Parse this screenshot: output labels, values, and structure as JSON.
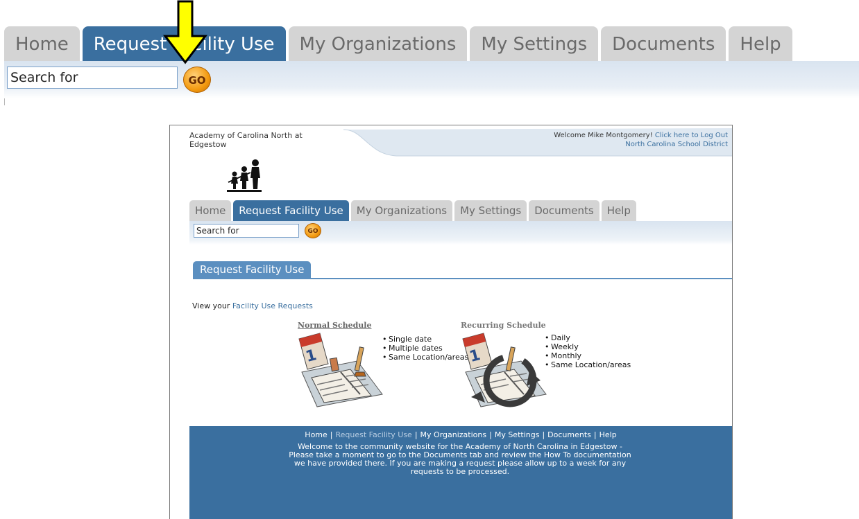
{
  "big_nav": {
    "tabs": [
      {
        "label": "Home",
        "active": false
      },
      {
        "label": "Request Facility Use",
        "active": true
      },
      {
        "label": "My Organizations",
        "active": false
      },
      {
        "label": "My Settings",
        "active": false
      },
      {
        "label": "Documents",
        "active": false
      },
      {
        "label": "Help",
        "active": false
      }
    ],
    "search_value": "Search for",
    "go_label": "GO"
  },
  "panel": {
    "org_name": "Academy of Carolina North at Edgestow",
    "welcome_text": "Welcome Mike Montgomery!",
    "logout_link": "Click here to Log Out",
    "district_link": "North Carolina School District",
    "nav": {
      "tabs": [
        {
          "label": "Home",
          "active": false
        },
        {
          "label": "Request Facility Use",
          "active": true
        },
        {
          "label": "My Organizations",
          "active": false
        },
        {
          "label": "My Settings",
          "active": false
        },
        {
          "label": "Documents",
          "active": false
        },
        {
          "label": "Help",
          "active": false
        }
      ],
      "search_value": "Search for",
      "go_label": "GO"
    },
    "section_title": "Request Facility Use",
    "view_prefix": "View your",
    "view_link": "Facility Use Requests",
    "normal": {
      "title": "Normal Schedule",
      "bullets": [
        "Single date",
        "Multiple dates",
        "Same Location/areas"
      ]
    },
    "recurring": {
      "title": "Recurring Schedule",
      "bullets": [
        "Daily",
        "Weekly",
        "Monthly",
        "Same Location/areas"
      ]
    },
    "footer": {
      "links": [
        "Home",
        "Request Facility Use",
        "My Organizations",
        "My Settings",
        "Documents",
        "Help"
      ],
      "current": "Request Facility Use",
      "message": "Welcome to the community website for the Academy of North Carolina in Edgestow - Please take a moment to go to the Documents tab and review the How To documentation we have provided there. If you are making a request please allow up to a week for any requests to be processed."
    }
  },
  "colors": {
    "nav_active": "#3a6f9f",
    "nav_inactive": "#d4d4d4",
    "go_button": "#f39a10",
    "arrow": "#ffff00"
  }
}
